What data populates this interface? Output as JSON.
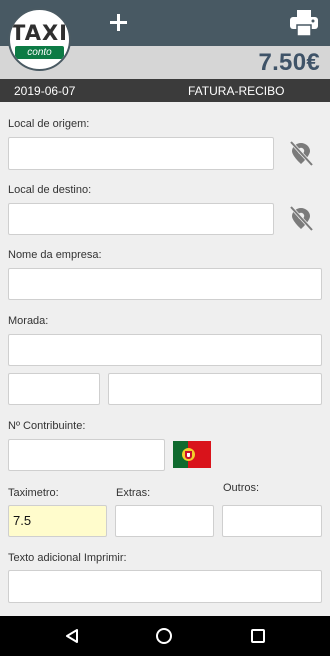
{
  "header": {
    "logo_text": "TAXI",
    "logo_subtext": "conto",
    "amount": "7.50€"
  },
  "infobar": {
    "date": "2019-06-07",
    "doc_type": "FATURA-RECIBO"
  },
  "form": {
    "origin_label": "Local de origem:",
    "origin_value": "",
    "destination_label": "Local de destino:",
    "destination_value": "",
    "company_label": "Nome da empresa:",
    "company_value": "",
    "address_label": "Morada:",
    "address_value": "",
    "postal_code_value": "",
    "city_value": "",
    "tax_id_label": "Nº Contribuinte:",
    "tax_id_value": "",
    "taximeter_label": "Taximetro:",
    "taximeter_value": "7.5",
    "extras_label": "Extras:",
    "extras_value": "",
    "others_label": "Outros:",
    "others_value": "",
    "extra_text_label": "Texto adicional Imprimir:",
    "extra_text_value": ""
  },
  "icons": {
    "add": "plus-icon",
    "print": "printer-icon",
    "location_off": "location-off-icon",
    "country_flag": "portugal-flag-icon"
  },
  "colors": {
    "topbar": "#485963",
    "amount": "#3f5368",
    "infobar": "#3b3b3b",
    "active_field": "#fffccc",
    "flag_green": "#0f6a2e",
    "flag_red": "#d9131b"
  }
}
